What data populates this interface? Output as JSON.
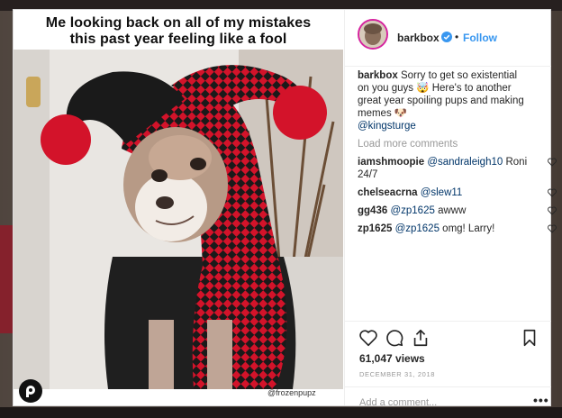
{
  "meme": {
    "caption_line1": "Me looking back on all of my mistakes",
    "caption_line2": "this past year feeling like a fool",
    "watermark": "@frozenpupz"
  },
  "post": {
    "username": "barkbox",
    "follow_label": "Follow",
    "separator": "•"
  },
  "caption": {
    "user": "barkbox",
    "text": "Sorry to get so existential on you guys 🤯 Here's to another great year spoiling pups and making memes 🐶",
    "mention": "@kingsturge"
  },
  "load_more": "Load more comments",
  "comments": [
    {
      "user": "iamshmoopie",
      "mention": "@sandraleigh10",
      "text": "Roni 24/7"
    },
    {
      "user": "chelseacrna",
      "mention": "@slew11",
      "text": ""
    },
    {
      "user": "gg436",
      "mention": "@zp1625",
      "text": "awww"
    },
    {
      "user": "zp1625",
      "mention": "@zp1625",
      "text": "omg! Larry!"
    }
  ],
  "stats": {
    "views": "61,047 views",
    "date": "DECEMBER 31, 2018"
  },
  "add_comment_placeholder": "Add a comment...",
  "more_label": "•••",
  "colors": {
    "link_blue": "#3897f0",
    "mention": "#003569",
    "jester_red": "#d3132a",
    "jester_black": "#1a1a1a"
  },
  "icons": [
    "heart-icon",
    "comment-icon",
    "share-icon",
    "bookmark-icon",
    "verified-badge-icon",
    "avatar-image"
  ]
}
